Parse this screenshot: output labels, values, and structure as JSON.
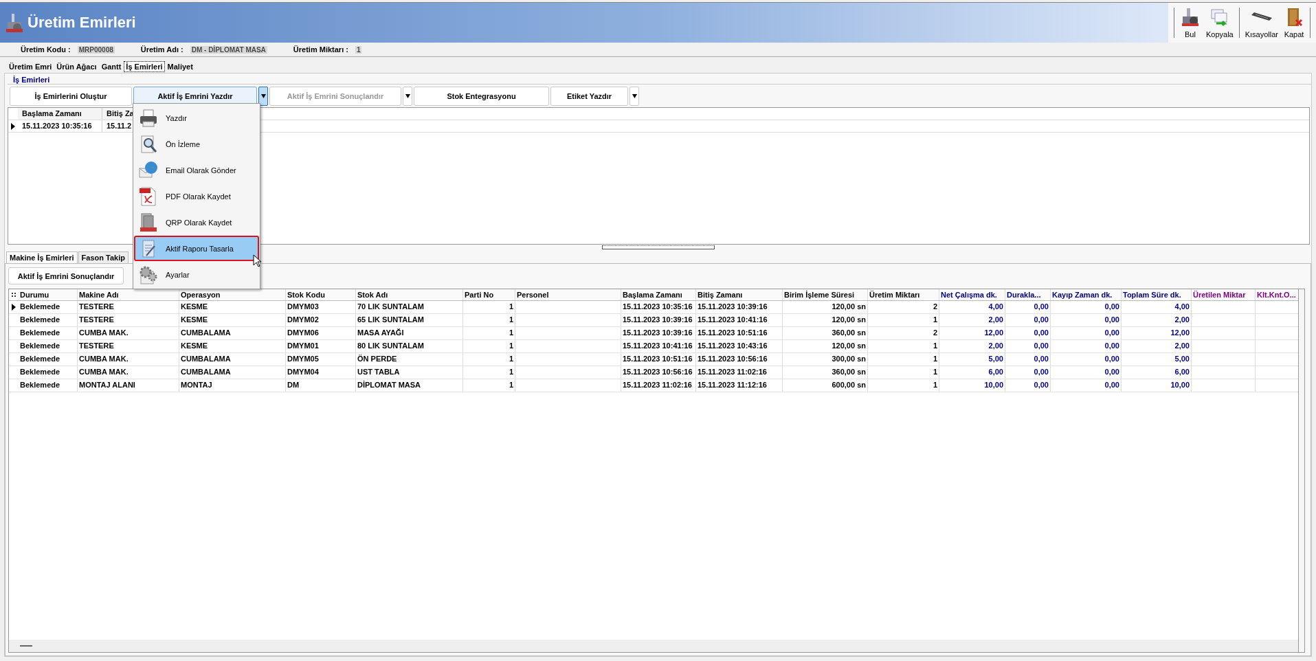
{
  "window": {
    "title": "Üretim Emirleri"
  },
  "toolbar": [
    {
      "label": "Bul"
    },
    {
      "label": "Kopyala"
    },
    {
      "label": "Kısayollar"
    },
    {
      "label": "Kapat"
    }
  ],
  "info": [
    {
      "label": "Üretim Kodu  :",
      "value": "MRP00008"
    },
    {
      "label": "Üretim Adı  :",
      "value": "DM - DİPLOMAT MASA"
    },
    {
      "label": "Üretim Miktarı  :",
      "value": "1"
    }
  ],
  "tabs": [
    {
      "label": "Üretim Emri",
      "selected": false
    },
    {
      "label": "Ürün Ağacı",
      "selected": false
    },
    {
      "label": "Gantt",
      "selected": false
    },
    {
      "label": "İş Emirleri",
      "selected": true
    },
    {
      "label": "Maliyet",
      "selected": false
    }
  ],
  "group": {
    "title": "İş Emirleri"
  },
  "buttons": [
    {
      "label": "İş Emirlerini Oluştur",
      "dropdown": false,
      "disabled": false,
      "open": false
    },
    {
      "label": "Aktif İş Emrini Yazdır",
      "dropdown": true,
      "disabled": false,
      "open": true
    },
    {
      "label": "Aktif İş Emrini Sonuçlandır",
      "dropdown": true,
      "disabled": true,
      "open": false
    },
    {
      "label": "Stok Entegrasyonu",
      "dropdown": false,
      "disabled": false,
      "open": false
    },
    {
      "label": "Etiket Yazdır",
      "dropdown": true,
      "disabled": false,
      "open": false
    }
  ],
  "upper_grid": {
    "columns": [
      "Başlama Zamanı",
      "Bitiş Za"
    ],
    "rows": [
      {
        "selected": true,
        "cells": [
          "15.11.2023 10:35:16",
          "15.11.2"
        ]
      }
    ]
  },
  "menu": [
    {
      "label": "Yazdır",
      "selected": false
    },
    {
      "label": "Ön İzleme",
      "selected": false
    },
    {
      "label": "Email Olarak Gönder",
      "selected": false
    },
    {
      "label": "PDF Olarak Kaydet",
      "selected": false
    },
    {
      "label": "QRP Olarak Kaydet",
      "selected": false
    },
    {
      "label": "Aktif Raporu Tasarla",
      "selected": true
    },
    {
      "label": "Ayarlar",
      "selected": false
    }
  ],
  "lower_tabs": [
    {
      "label": "Makine İş Emirleri",
      "selected": true
    },
    {
      "label": "Fason Takip",
      "selected": false
    }
  ],
  "lower_button": {
    "label": "Aktif İş Emrini Sonuçlandır"
  },
  "grid": {
    "columns": [
      {
        "label": "Durumu",
        "kind": "text"
      },
      {
        "label": "Makine Adı",
        "kind": "text"
      },
      {
        "label": "Operasyon",
        "kind": "text"
      },
      {
        "label": "Stok Kodu",
        "kind": "text"
      },
      {
        "label": "Stok Adı",
        "kind": "text"
      },
      {
        "label": "Parti No",
        "kind": "number"
      },
      {
        "label": "Personel",
        "kind": "text"
      },
      {
        "label": "Başlama Zamanı",
        "kind": "text"
      },
      {
        "label": "Bitiş Zamanı",
        "kind": "text"
      },
      {
        "label": "Birim İşleme Süresi",
        "kind": "number"
      },
      {
        "label": "Üretim Miktarı",
        "kind": "number"
      },
      {
        "label": "Net Çalışma dk.",
        "kind": "number",
        "color": "#000080"
      },
      {
        "label": "Durakla...",
        "kind": "number",
        "color": "#000080"
      },
      {
        "label": "Kayıp Zaman dk.",
        "kind": "number",
        "color": "#000080"
      },
      {
        "label": "Toplam Süre dk.",
        "kind": "number",
        "color": "#000080"
      },
      {
        "label": "Üretilen Miktar",
        "kind": "number",
        "color": "#800080"
      },
      {
        "label": "Klt.Knt.O...",
        "kind": "number",
        "color": "#800080"
      }
    ],
    "rows": [
      {
        "selected": true,
        "cells": [
          "Beklemede",
          "TESTERE",
          "KESME",
          "DMYM03",
          "70 LIK SUNTALAM",
          "1",
          null,
          "15.11.2023 10:35:16",
          "15.11.2023 10:39:16",
          "120,00 sn",
          "2",
          "4,00",
          "0,00",
          "0,00",
          "4,00",
          null,
          null
        ]
      },
      {
        "selected": false,
        "cells": [
          "Beklemede",
          "TESTERE",
          "KESME",
          "DMYM02",
          "65 LIK SUNTALAM",
          "1",
          null,
          "15.11.2023 10:39:16",
          "15.11.2023 10:41:16",
          "120,00 sn",
          "1",
          "2,00",
          "0,00",
          "0,00",
          "2,00",
          null,
          null
        ]
      },
      {
        "selected": false,
        "cells": [
          "Beklemede",
          "CUMBA MAK.",
          "CUMBALAMA",
          "DMYM06",
          "MASA AYAĞI",
          "1",
          null,
          "15.11.2023 10:39:16",
          "15.11.2023 10:51:16",
          "360,00 sn",
          "2",
          "12,00",
          "0,00",
          "0,00",
          "12,00",
          null,
          null
        ]
      },
      {
        "selected": false,
        "cells": [
          "Beklemede",
          "TESTERE",
          "KESME",
          "DMYM01",
          "80 LIK SUNTALAM",
          "1",
          null,
          "15.11.2023 10:41:16",
          "15.11.2023 10:43:16",
          "120,00 sn",
          "1",
          "2,00",
          "0,00",
          "0,00",
          "2,00",
          null,
          null
        ]
      },
      {
        "selected": false,
        "cells": [
          "Beklemede",
          "CUMBA MAK.",
          "CUMBALAMA",
          "DMYM05",
          "ÖN PERDE",
          "1",
          null,
          "15.11.2023 10:51:16",
          "15.11.2023 10:56:16",
          "300,00 sn",
          "1",
          "5,00",
          "0,00",
          "0,00",
          "5,00",
          null,
          null
        ]
      },
      {
        "selected": false,
        "cells": [
          "Beklemede",
          "CUMBA MAK.",
          "CUMBALAMA",
          "DMYM04",
          "UST TABLA",
          "1",
          null,
          "15.11.2023 10:56:16",
          "15.11.2023 11:02:16",
          "360,00 sn",
          "1",
          "6,00",
          "0,00",
          "0,00",
          "6,00",
          null,
          null
        ]
      },
      {
        "selected": false,
        "cells": [
          "Beklemede",
          "MONTAJ ALANI",
          "MONTAJ",
          "DM",
          "DİPLOMAT MASA",
          "1",
          null,
          "15.11.2023 11:02:16",
          "15.11.2023 11:12:16",
          "600,00 sn",
          "1",
          "10,00",
          "0,00",
          "0,00",
          "10,00",
          null,
          null
        ]
      }
    ]
  }
}
